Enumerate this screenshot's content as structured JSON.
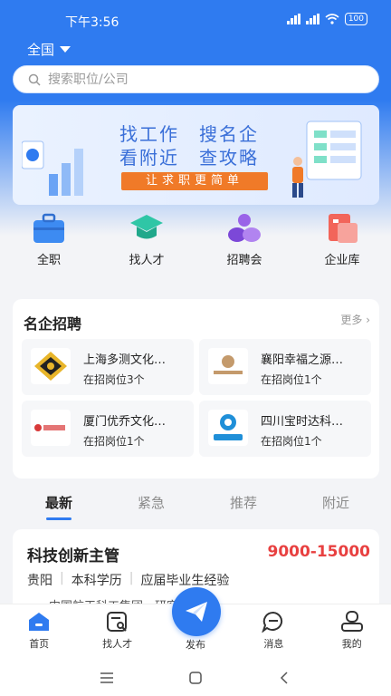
{
  "status": {
    "time": "下午3:56",
    "battery": "100"
  },
  "header": {
    "location": "全国",
    "search_placeholder": "搜索职位/公司"
  },
  "banner": {
    "line1": "找工作　搜名企",
    "line2": "看附近　查攻略",
    "cta": "让求职更简单"
  },
  "quick_links": [
    {
      "label": "全职",
      "icon": "briefcase-icon"
    },
    {
      "label": "找人才",
      "icon": "graduation-cap-icon"
    },
    {
      "label": "招聘会",
      "icon": "people-group-icon"
    },
    {
      "label": "企业库",
      "icon": "company-building-icon"
    }
  ],
  "companies": {
    "title": "名企招聘",
    "more": "更多 ›",
    "items": [
      {
        "name": "上海多测文化…",
        "positions": "在招岗位3个"
      },
      {
        "name": "襄阳幸福之源…",
        "positions": "在招岗位1个"
      },
      {
        "name": "厦门优乔文化…",
        "positions": "在招岗位1个"
      },
      {
        "name": "四川宝时达科…",
        "positions": "在招岗位1个"
      }
    ]
  },
  "tabs": [
    "最新",
    "紧急",
    "推荐",
    "附近"
  ],
  "job": {
    "title": "科技创新主管",
    "salary": "9000-15000",
    "tags": [
      "贵阳",
      "本科学历",
      "应届毕业生经验"
    ],
    "company": "中国航天科工集团…研究院"
  },
  "bottom_nav": [
    {
      "label": "首页",
      "icon": "home-icon"
    },
    {
      "label": "找人才",
      "icon": "find-talent-icon"
    },
    {
      "label": "发布",
      "icon": "send-icon"
    },
    {
      "label": "消息",
      "icon": "message-icon"
    },
    {
      "label": "我的",
      "icon": "profile-icon"
    }
  ],
  "colors": {
    "brand": "#2f7bf0",
    "salary": "#e84040",
    "cta": "#f07a28"
  }
}
